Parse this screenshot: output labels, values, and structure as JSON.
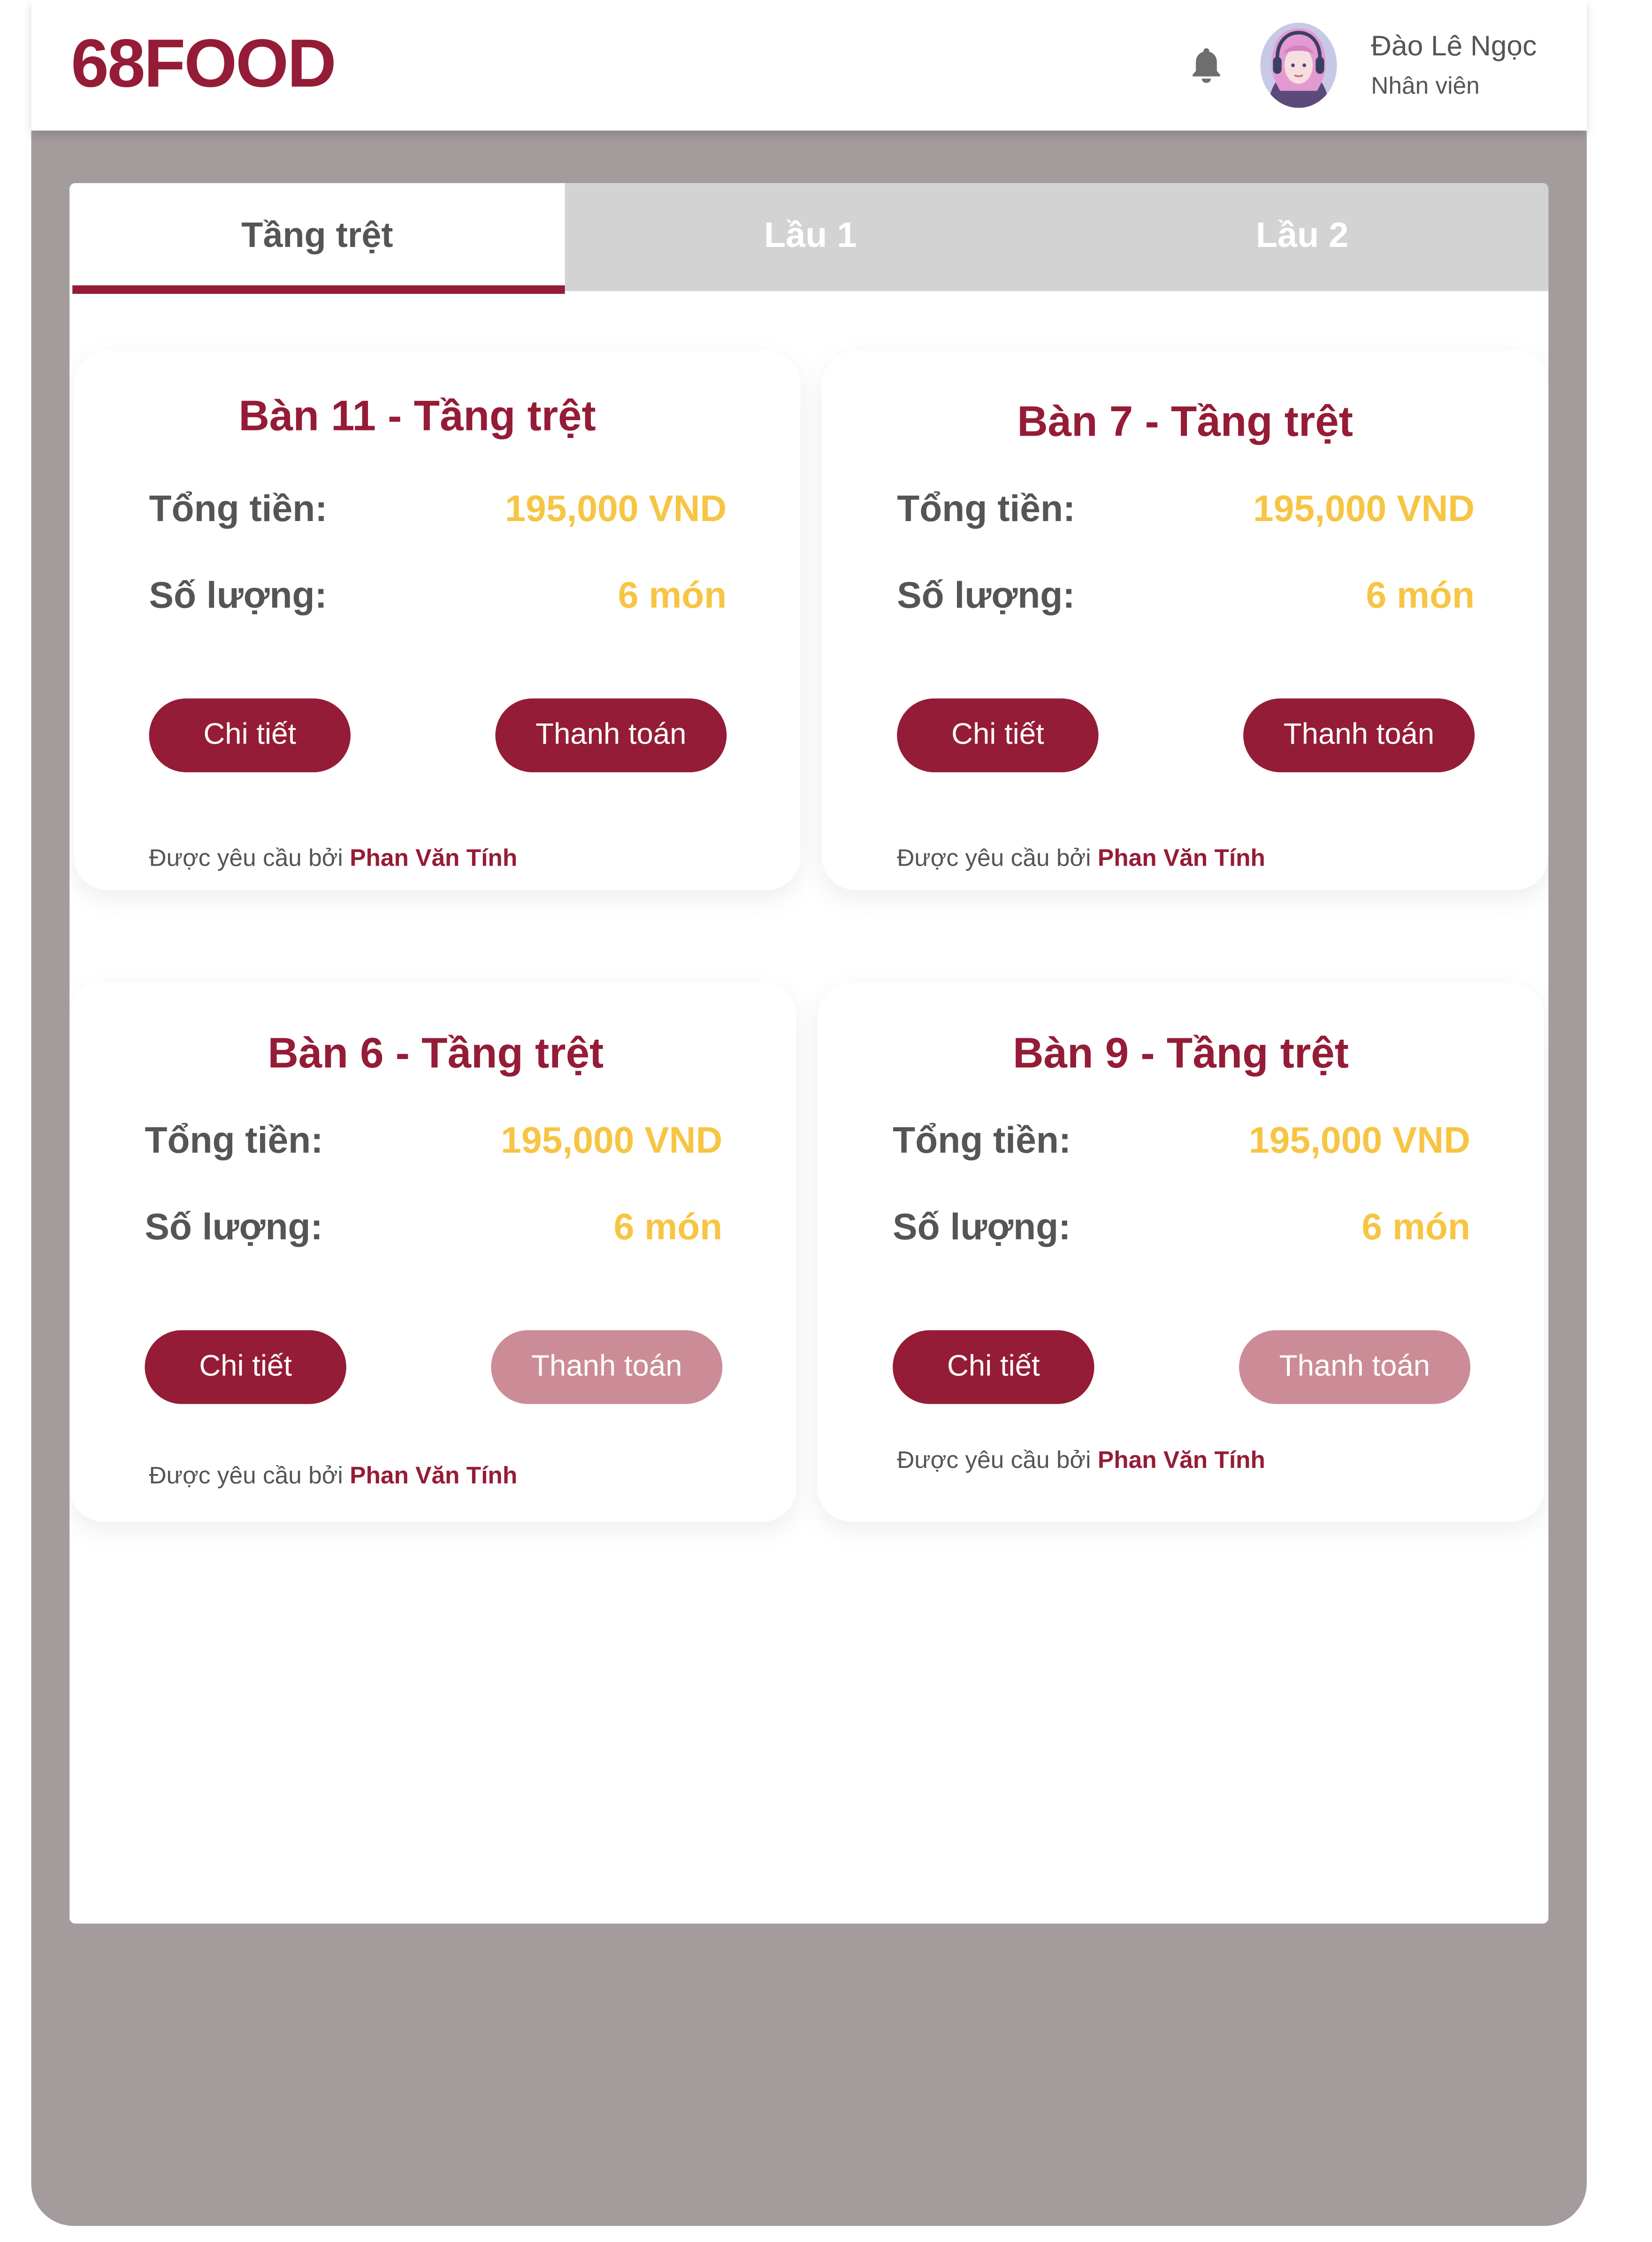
{
  "header": {
    "logo": "68FOOD",
    "user_name": "Đào Lê Ngọc",
    "user_role": "Nhân viên",
    "notification_icon": "bell-icon"
  },
  "tabs": [
    {
      "label": "Tầng trệt",
      "active": true
    },
    {
      "label": "Lầu 1",
      "active": false
    },
    {
      "label": "Lầu 2",
      "active": false
    }
  ],
  "cards": [
    {
      "title": "Bàn 11 - Tầng trệt",
      "total_label": "Tổng tiền:",
      "total_value": "195,000 VND",
      "qty_label": "Số lượng:",
      "qty_value": "6 món",
      "detail_label": "Chi tiết",
      "pay_label": "Thanh toán",
      "pay_enabled": true,
      "requested_prefix": "Được yêu cầu bởi",
      "requested_by": "Phan Văn Tính"
    },
    {
      "title": "Bàn 7 - Tầng trệt",
      "total_label": "Tổng tiền:",
      "total_value": "195,000 VND",
      "qty_label": "Số lượng:",
      "qty_value": "6 món",
      "detail_label": "Chi tiết",
      "pay_label": "Thanh toán",
      "pay_enabled": true,
      "requested_prefix": "Được yêu cầu bởi",
      "requested_by": "Phan Văn Tính"
    },
    {
      "title": "Bàn 6 - Tầng trệt",
      "total_label": "Tổng tiền:",
      "total_value": "195,000 VND",
      "qty_label": "Số lượng:",
      "qty_value": "6 món",
      "detail_label": "Chi tiết",
      "pay_label": "Thanh toán",
      "pay_enabled": false,
      "requested_prefix": "Được yêu cầu bởi",
      "requested_by": "Phan Văn Tính"
    },
    {
      "title": "Bàn 9 - Tầng trệt",
      "total_label": "Tổng tiền:",
      "total_value": "195,000 VND",
      "qty_label": "Số lượng:",
      "qty_value": "6 món",
      "detail_label": "Chi tiết",
      "pay_label": "Thanh toán",
      "pay_enabled": false,
      "requested_prefix": "Được yêu cầu bởi",
      "requested_by": "Phan Văn Tính"
    }
  ],
  "colors": {
    "brand": "#951c36",
    "value": "#f7c544",
    "disabled_button": "#cc8c97",
    "backdrop": "#a39b9c"
  }
}
